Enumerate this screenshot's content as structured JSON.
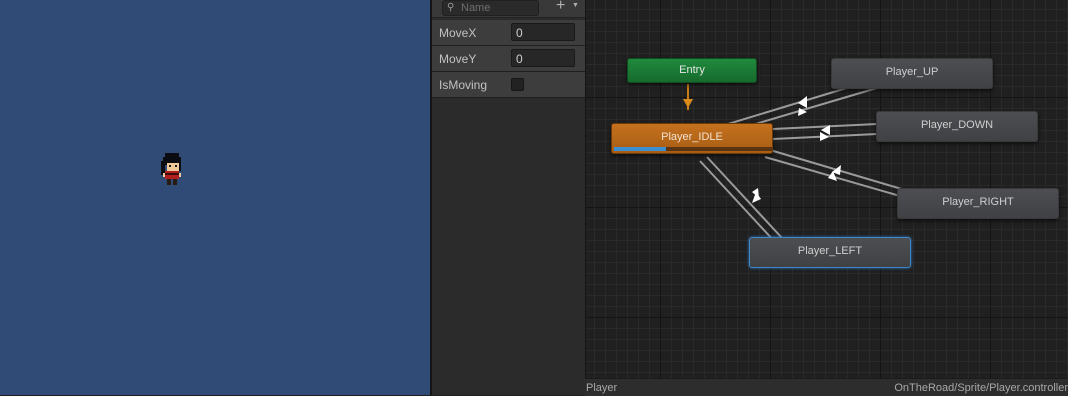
{
  "parameters": {
    "search_placeholder": "Name",
    "items": [
      {
        "name": "MoveX",
        "type": "float",
        "value": "0"
      },
      {
        "name": "MoveY",
        "type": "float",
        "value": "0"
      },
      {
        "name": "IsMoving",
        "type": "bool",
        "checked": false
      }
    ]
  },
  "graph": {
    "states": {
      "entry": "Entry",
      "idle": "Player_IDLE",
      "up": "Player_UP",
      "down": "Player_DOWN",
      "right": "Player_RIGHT",
      "left": "Player_LEFT"
    },
    "idle_progress": 0.33,
    "selected_state": "Player_LEFT"
  },
  "status_bar": {
    "layer": "Player",
    "path": "OnTheRoad/Sprite/Player.controller"
  },
  "colors": {
    "game_background": "#2f4b76",
    "entry_state": "#1f8a3c",
    "default_state": "#c5711e",
    "selection": "#3f86c9"
  }
}
